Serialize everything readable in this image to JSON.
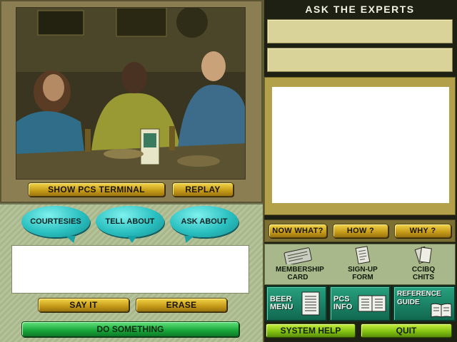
{
  "video": {
    "show_pcs_terminal_label": "SHOW PCS TERMINAL",
    "replay_label": "REPLAY"
  },
  "dialog": {
    "courtesies_label": "COURTESIES",
    "tell_about_label": "TELL ABOUT",
    "ask_about_label": "ASK ABOUT",
    "input_value": "",
    "say_it_label": "SAY IT",
    "erase_label": "ERASE",
    "do_something_label": "DO SOMETHING"
  },
  "experts": {
    "title": "ASK THE EXPERTS",
    "field1_value": "",
    "field2_value": "",
    "answer_text": ""
  },
  "help": {
    "now_what_label": "NOW WHAT?",
    "how_label": "HOW ?",
    "why_label": "WHY ?"
  },
  "documents": {
    "membership_card": "MEMBERSHIP CARD",
    "signup_form": "SIGN-UP FORM",
    "ccibq_chits": "CCIBQ CHITS"
  },
  "menus": {
    "beer_menu": "BEER MENU",
    "pcs_info": "PCS INFO",
    "reference_guide": "REFERENCE GUIDE"
  },
  "footer": {
    "system_help_label": "SYSTEM HELP",
    "quit_label": "QUIT"
  },
  "colors": {
    "gold_button": "#d9b42c",
    "bubble_teal": "#2bc0c0",
    "action_green": "#17a53a",
    "footer_green": "#8fcf1a"
  }
}
